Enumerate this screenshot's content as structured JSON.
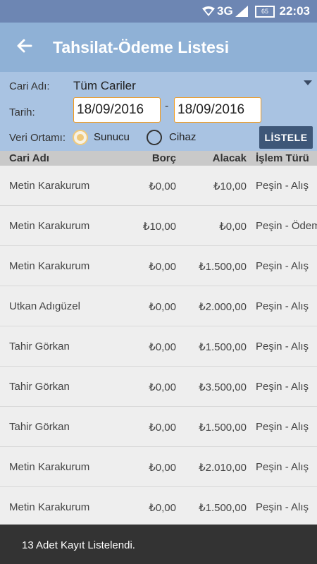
{
  "status": {
    "network": "3G",
    "battery": "65",
    "time": "22:03"
  },
  "appbar": {
    "title": "Tahsilat-Ödeme Listesi"
  },
  "filters": {
    "cari_label": "Cari Adı:",
    "cari_value": "Tüm Cariler",
    "tarih_label": "Tarih:",
    "date_from": "18/09/2016",
    "date_to": "18/09/2016",
    "separator": "-",
    "ortam_label": "Veri Ortamı:",
    "option_server": "Sunucu",
    "option_device": "Cihaz",
    "selected": "Sunucu",
    "list_button": "LİSTELE"
  },
  "table": {
    "headers": {
      "name": "Cari Adı",
      "borc": "Borç",
      "alacak": "Alacak",
      "tur": "İşlem Türü"
    },
    "rows": [
      {
        "name": "Metin Karakurum",
        "borc": "₺0,00",
        "alacak": "₺10,00",
        "tur": "Peşin - Alış"
      },
      {
        "name": "Metin Karakurum",
        "borc": "₺10,00",
        "alacak": "₺0,00",
        "tur": "Peşin - Ödem"
      },
      {
        "name": "Metin Karakurum",
        "borc": "₺0,00",
        "alacak": "₺1.500,00",
        "tur": "Peşin - Alış"
      },
      {
        "name": "Utkan Adıgüzel",
        "borc": "₺0,00",
        "alacak": "₺2.000,00",
        "tur": "Peşin - Alış"
      },
      {
        "name": "Tahir Görkan",
        "borc": "₺0,00",
        "alacak": "₺1.500,00",
        "tur": "Peşin - Alış"
      },
      {
        "name": "Tahir Görkan",
        "borc": "₺0,00",
        "alacak": "₺3.500,00",
        "tur": "Peşin - Alış"
      },
      {
        "name": "Tahir Görkan",
        "borc": "₺0,00",
        "alacak": "₺1.500,00",
        "tur": "Peşin - Alış"
      },
      {
        "name": "Metin Karakurum",
        "borc": "₺0,00",
        "alacak": "₺2.010,00",
        "tur": "Peşin - Alış"
      },
      {
        "name": "Metin Karakurum",
        "borc": "₺0,00",
        "alacak": "₺1.500,00",
        "tur": "Peşin - Alış"
      }
    ]
  },
  "toast": {
    "message": "13 Adet Kayıt Listelendi."
  },
  "colors": {
    "statusbar": "#6d86b3",
    "appbar": "#8fb1d6",
    "filters": "#a9c3e2",
    "button": "#3e5778",
    "date_border": "#f29a1c",
    "toast": "#333333"
  }
}
